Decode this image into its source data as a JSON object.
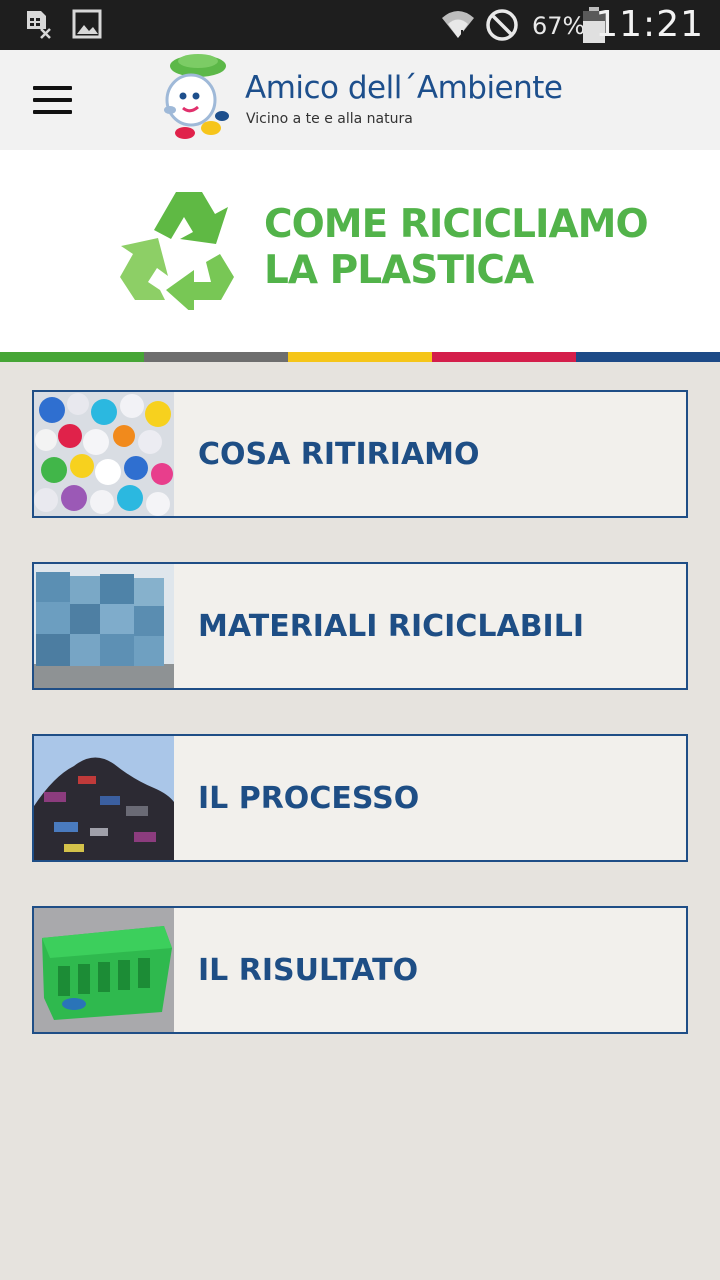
{
  "status_bar": {
    "time": "11:21",
    "battery_percent": "67%",
    "icons": [
      "sim-card-icon",
      "image-icon",
      "wifi-icon",
      "do-not-disturb-icon",
      "battery-icon"
    ]
  },
  "header": {
    "app_title": "Amico dell´Ambiente",
    "tagline": "Vicino a te e alla natura",
    "menu_icon": "hamburger-menu-icon"
  },
  "hero": {
    "title_line1": "COME RICICLIAMO",
    "title_line2": "LA PLASTICA",
    "icon": "recycle-icon",
    "title_color": "#52b34a"
  },
  "stripe_colors": [
    "#46a536",
    "#6e6e6e",
    "#f5c518",
    "#d41e4a",
    "#1d4a87"
  ],
  "menu": {
    "items": [
      {
        "label": "COSA RITIRIAMO",
        "image": "bottle-caps-image"
      },
      {
        "label": "MATERIALI RICICLABILI",
        "image": "plastic-bales-image"
      },
      {
        "label": "IL PROCESSO",
        "image": "waste-pile-image"
      },
      {
        "label": "IL RISULTATO",
        "image": "green-crate-image"
      }
    ]
  },
  "colors": {
    "accent_blue": "#1e4e85",
    "background": "#e6e3de",
    "card_background": "#f2f0ec"
  }
}
